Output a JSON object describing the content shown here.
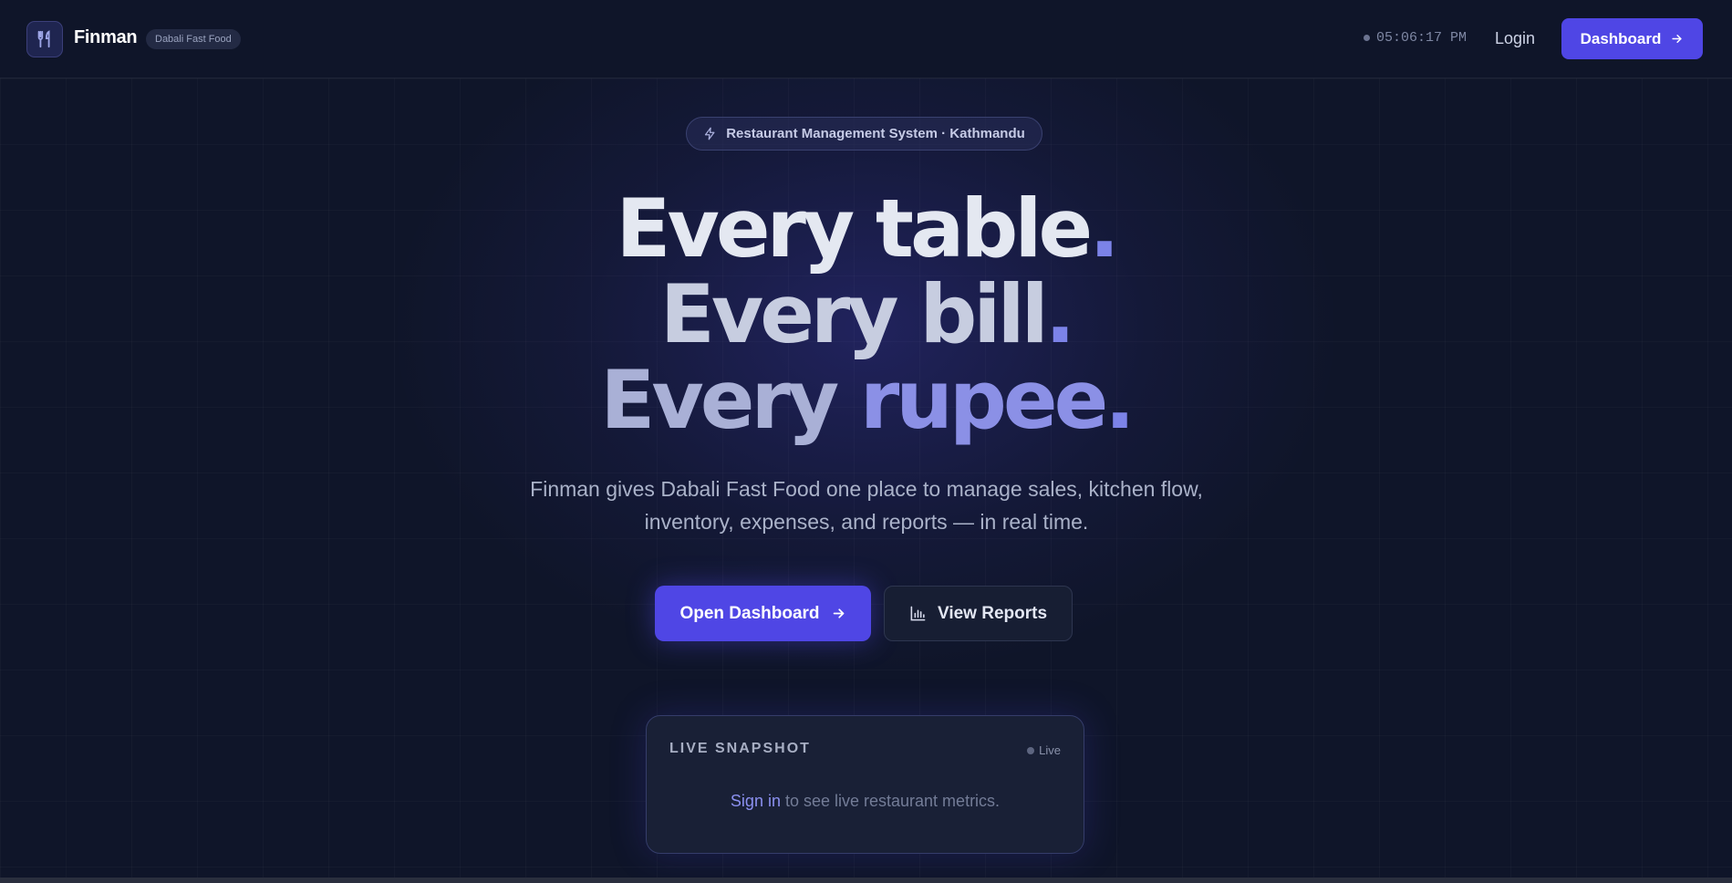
{
  "header": {
    "brand": "Finman",
    "badge": "Dabali Fast Food",
    "clock": "05:06:17 PM",
    "login_label": "Login",
    "dashboard_label": "Dashboard"
  },
  "hero": {
    "pill": "Restaurant Management System · Kathmandu",
    "line1_a": "Every ",
    "line1_b": "table",
    "line2_a": "Every ",
    "line2_b": "bill",
    "line3_a": "Every ",
    "line3_b": "rupee",
    "dot": ".",
    "subtitle": "Finman gives Dabali Fast Food one place to manage sales, kitchen flow, inventory, expenses, and reports — in real time.",
    "primary_cta": "Open Dashboard",
    "secondary_cta": "View Reports"
  },
  "snapshot": {
    "title": "LIVE SNAPSHOT",
    "live_label": "Live",
    "signin_link": "Sign in",
    "message": " to see live restaurant metrics."
  },
  "colors": {
    "accent": "#4f46e5",
    "background": "#0f1529",
    "card": "#192036"
  },
  "icons": {
    "logo": "fork-knife-icon",
    "pill": "lightning-icon",
    "arrow": "arrow-right-icon",
    "reports": "bar-chart-icon"
  }
}
